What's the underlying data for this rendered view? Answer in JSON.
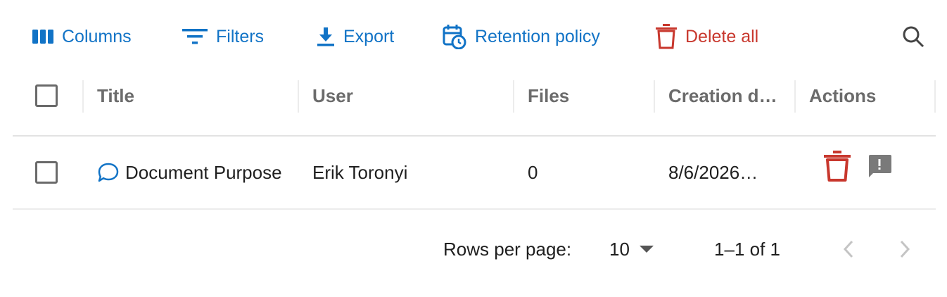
{
  "toolbar": {
    "columns_label": "Columns",
    "filters_label": "Filters",
    "export_label": "Export",
    "retention_label": "Retention policy",
    "delete_all_label": "Delete all",
    "search_icon": "search-icon"
  },
  "table": {
    "columns": [
      "Title",
      "User",
      "Files",
      "Creation d…",
      "Actions"
    ],
    "rows": [
      {
        "title": "Document Purpose",
        "title_icon": "chat-bubble-icon",
        "user": "Erik Toronyi",
        "files": "0",
        "created": "8/6/2026…",
        "actions": [
          "trash-icon",
          "feedback-icon"
        ]
      }
    ]
  },
  "pagination": {
    "rows_per_page_label": "Rows per page:",
    "rows_per_page_value": "10",
    "range": "1–1 of 1"
  },
  "colors": {
    "accent": "#1173c6",
    "danger": "#c8372d",
    "header_text": "#6b6b6b",
    "muted_icon": "#7a7a7a"
  }
}
